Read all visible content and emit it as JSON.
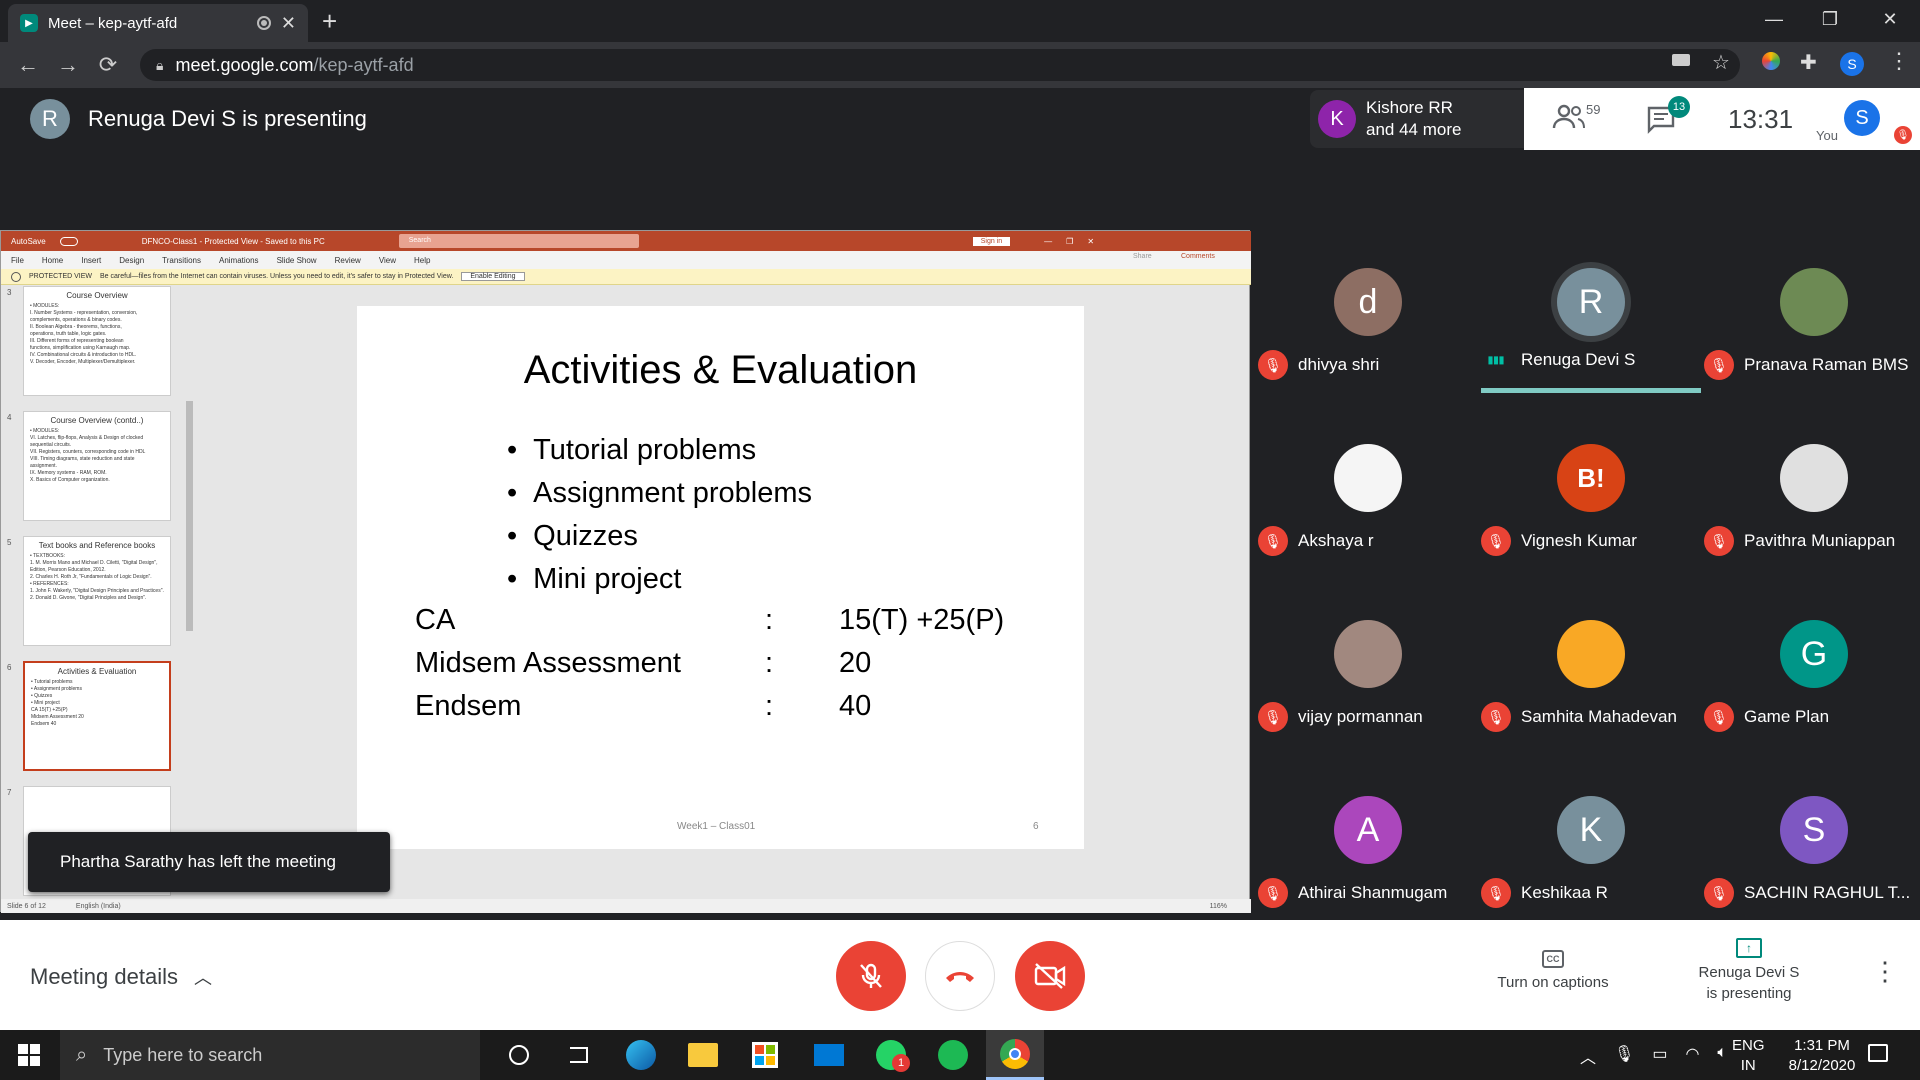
{
  "browser": {
    "tab_title": "Meet – kep-aytf-afd",
    "url_host": "meet.google.com",
    "url_path": "/kep-aytf-afd",
    "profile_initial": "S"
  },
  "meet": {
    "presenter_initial": "R",
    "presenting_text": "Renuga Devi S is presenting",
    "recent_speaker_initial": "K",
    "recent_speaker_line1": "Kishore RR",
    "recent_speaker_line2": "and 44 more",
    "participants_count": "59",
    "chat_badge": "13",
    "time": "13:31",
    "you_label": "You",
    "you_initial": "S"
  },
  "ppt": {
    "autosave": "AutoSave",
    "file_title": "DFNCO-Class1 - Protected View - Saved to this PC",
    "search_placeholder": "Search",
    "sign_in": "Sign in",
    "menu": [
      "File",
      "Home",
      "Insert",
      "Design",
      "Transitions",
      "Animations",
      "Slide Show",
      "Review",
      "View",
      "Help"
    ],
    "share": "Share",
    "comments": "Comments",
    "protected_label": "PROTECTED VIEW",
    "protected_msg": "Be careful—files from the Internet can contain viruses. Unless you need to edit, it's safer to stay in Protected View.",
    "enable_editing": "Enable Editing",
    "status_slide": "Slide 6 of 12",
    "status_lang": "English (India)",
    "zoom": "116%",
    "thumbnails": [
      {
        "num": "3",
        "title": "Course Overview",
        "lines": [
          "• MODULES:",
          "I. Number Systems - representation, conversion,",
          "complements, operations & binary codes.",
          "II. Boolean Algebra - theorems, functions,",
          "operations, truth table, logic gates.",
          "III. Different forms of representing boolean",
          "functions, simplification using Karnaugh map.",
          "IV. Combinational circuits & introduction to HDL.",
          "V. Decoder, Encoder, Multiplexer/Demultiplexer."
        ]
      },
      {
        "num": "4",
        "title": "Course Overview (contd..)",
        "lines": [
          "• MODULES:",
          "VI. Latches, flip-flops, Analysis & Design of clocked",
          "sequential circuits.",
          "VII. Registers, counters, corresponding code in HDL",
          "VIII. Timing diagrams, state reduction and state",
          "assignment.",
          "IX. Memory systems - RAM, ROM.",
          "X. Basics of Computer organization."
        ]
      },
      {
        "num": "5",
        "title": "Text books and Reference books",
        "lines": [
          "• TEXTBOOKS:",
          "1. M. Morris Mano and Michael D. Ciletti, \"Digital Design\",",
          "Edition, Pearson Education, 2012.",
          "2. Charles H. Roth Jr, \"Fundamentals of Logic Design\".",
          "• REFERENCES:",
          "1. John F. Wakerly, \"Digital Design Principles and Practices\".",
          "2. Donald D. Givone, \"Digital Principles and Design\"."
        ]
      },
      {
        "num": "6",
        "title": "Activities & Evaluation",
        "lines": [
          "• Tutorial problems",
          "• Assignment problems",
          "• Quizzes",
          "• Mini project",
          "CA            15(T) +25(P)",
          "Midsem Assessment    20",
          "Endsem            40"
        ]
      },
      {
        "num": "7",
        "title": "",
        "lines": []
      }
    ]
  },
  "slide": {
    "title": "Activities & Evaluation",
    "bullets": [
      "Tutorial problems",
      "Assignment problems",
      "Quizzes",
      "Mini project"
    ],
    "rows": [
      {
        "label": "CA",
        "sep": ":",
        "value": "15(T) +25(P)"
      },
      {
        "label": "Midsem Assessment",
        "sep": ":",
        "value": "20"
      },
      {
        "label": "Endsem",
        "sep": ":",
        "value": "40"
      }
    ],
    "footer": "Week1 – Class01",
    "page_num": "6"
  },
  "toast": "Phartha Sarathy has left the meeting",
  "participants": [
    {
      "name": "dhivya shri",
      "initial": "d",
      "color": "#8d6e63",
      "speaking": false
    },
    {
      "name": "Renuga Devi S",
      "initial": "R",
      "color": "#78909c",
      "speaking": true
    },
    {
      "name": "Pranava Raman BMS",
      "initial": "",
      "color": "#6d8a54",
      "speaking": false
    },
    {
      "name": "Akshaya r",
      "initial": "",
      "color": "#f5f5f5",
      "speaking": false
    },
    {
      "name": "Vignesh Kumar",
      "initial": "B!",
      "color": "#d84315",
      "speaking": false
    },
    {
      "name": "Pavithra Muniappan",
      "initial": "",
      "color": "#e0e0e0",
      "speaking": false
    },
    {
      "name": "vijay pormannan",
      "initial": "",
      "color": "#a1887f",
      "speaking": false
    },
    {
      "name": "Samhita Mahadevan",
      "initial": "",
      "color": "#f9a825",
      "speaking": false
    },
    {
      "name": "Game Plan",
      "initial": "G",
      "color": "#009688",
      "speaking": false
    },
    {
      "name": "Athirai Shanmugam",
      "initial": "A",
      "color": "#ab47bc",
      "speaking": false
    },
    {
      "name": "Keshikaa R",
      "initial": "K",
      "color": "#78909c",
      "speaking": false
    },
    {
      "name": "SACHIN RAGHUL T...",
      "initial": "S",
      "color": "#7e57c2",
      "speaking": false
    }
  ],
  "bottom": {
    "meeting_details": "Meeting details",
    "captions": "Turn on captions",
    "present_line1": "Renuga Devi S",
    "present_line2": "is presenting"
  },
  "taskbar": {
    "search_placeholder": "Type here to search",
    "lang1": "ENG",
    "lang2": "IN",
    "time": "1:31 PM",
    "date": "8/12/2020",
    "whatsapp_badge": "1"
  },
  "colors": {
    "accent": "#00897b",
    "danger": "#ea4335",
    "ppt_red": "#b7472a"
  }
}
